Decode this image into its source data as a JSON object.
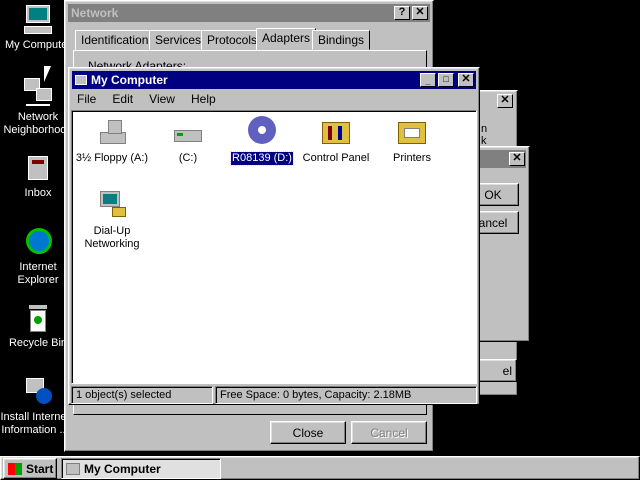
{
  "desktop": {
    "icons": [
      {
        "label": "My Computer"
      },
      {
        "label": "Network Neighborhood"
      },
      {
        "label": "Inbox"
      },
      {
        "label": "Internet Explorer"
      },
      {
        "label": "Recycle Bin"
      },
      {
        "label": "Install Internet Information ..."
      }
    ]
  },
  "network_dialog": {
    "title": "Network",
    "tabs": [
      "Identification",
      "Services",
      "Protocols",
      "Adapters",
      "Bindings"
    ],
    "active_tab": "Adapters",
    "partial_label": "Network Adapters:",
    "close_label": "Close",
    "cancel_label": "Cancel"
  },
  "behind_dialog": {
    "ok_label": "OK",
    "cancel_label": "ancel",
    "partial_text_1": "n",
    "partial_text_2": "k",
    "partial_button": "el"
  },
  "my_computer": {
    "title": "My Computer",
    "menu": {
      "file": "File",
      "edit": "Edit",
      "view": "View",
      "help": "Help"
    },
    "items": [
      {
        "label": "3½ Floppy (A:)"
      },
      {
        "label": "(C:)"
      },
      {
        "label": "R08139 (D:)"
      },
      {
        "label": "Control Panel"
      },
      {
        "label": "Printers"
      },
      {
        "label": "Dial-Up Networking"
      }
    ],
    "selected_item": "R08139 (D:)",
    "status": {
      "left": "1 object(s) selected",
      "right": "Free Space: 0 bytes,  Capacity: 2.18MB"
    }
  },
  "taskbar": {
    "start_label": "Start",
    "tasks": [
      {
        "label": "My Computer"
      }
    ]
  },
  "colors": {
    "desktop": "#000000",
    "titlebar_active": "#000080",
    "titlebar_inactive": "#808080",
    "face": "#c0c0c0",
    "selection": "#000080"
  }
}
